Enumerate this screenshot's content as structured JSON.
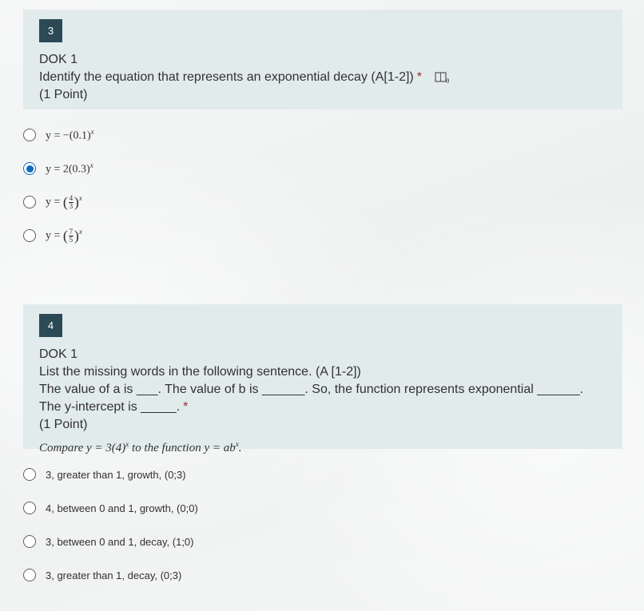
{
  "q3": {
    "number": "3",
    "level": "DOK 1",
    "prompt": "Identify the equation that represents an exponential decay (A[1-2])",
    "required_mark": "*",
    "points": "(1 Point)",
    "options": [
      {
        "lhs": "y = −(0.1)",
        "exp": "x",
        "selected": false
      },
      {
        "lhs": "y = 2(0.3)",
        "exp": "x",
        "selected": true
      },
      {
        "lhs": "y =",
        "num": "4",
        "den": "3",
        "exp": "x",
        "selected": false
      },
      {
        "lhs": "y =",
        "num": "7",
        "den": "5",
        "exp": "x",
        "selected": false
      }
    ]
  },
  "q4": {
    "number": "4",
    "level": "DOK 1",
    "line1": "List the missing words in the following sentence. (A [1-2])",
    "line2": "The value of a is ___. The value of b is ______. So, the function represents exponential ______.",
    "line3": "The y-intercept is _____.",
    "required_mark": "*",
    "points": "(1 Point)",
    "math_prefix": "Compare y = 3(4)",
    "math_exp1": "x",
    "math_middle": " to the function y  = ab",
    "math_exp2": "x",
    "math_suffix": ".",
    "options": [
      "3, greater than 1, growth, (0;3)",
      "4, between 0 and 1, growth, (0;0)",
      "3, between 0 and 1, decay, (1;0)",
      "3, greater than 1, decay, (0;3)"
    ]
  },
  "colors": {
    "header_bg": "#e1ebec",
    "number_badge": "#2b4a55",
    "accent": "#0f6cbd",
    "required": "#a4262c"
  },
  "icons": {
    "reader": "immersive-reader-icon"
  }
}
